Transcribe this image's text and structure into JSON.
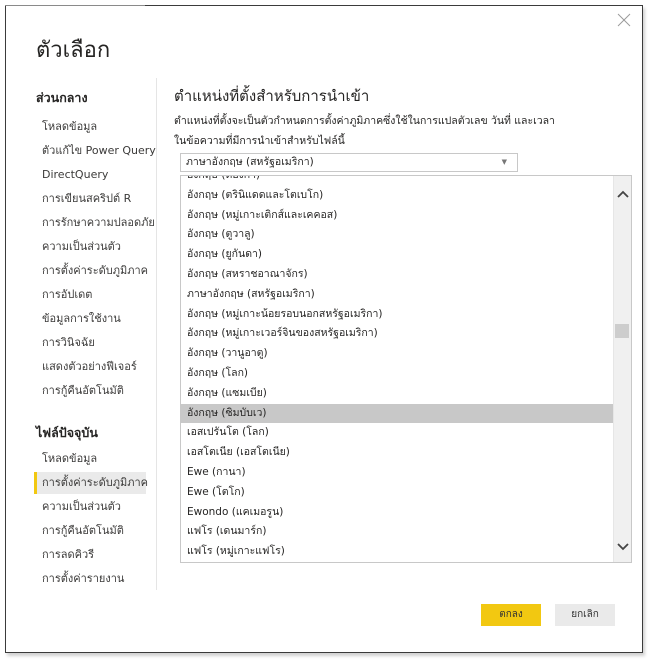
{
  "dialog": {
    "title": "ตัวเลือก",
    "close_icon": "close-icon"
  },
  "sidebar": {
    "global_heading": "ส่วนกลาง",
    "global_items": [
      "โหลดข้อมูล",
      "ตัวแก้ไข Power Query",
      "DirectQuery",
      "การเขียนสคริปต์ R",
      "การรักษาความปลอดภัย",
      "ความเป็นส่วนตัว",
      "การตั้งค่าระดับภูมิภาค",
      "การอัปเดต",
      "ข้อมูลการใช้งาน",
      "การวินิจฉัย",
      "แสดงตัวอย่างฟีเจอร์",
      "การกู้คืนอัตโนมัติ"
    ],
    "file_heading": "ไฟล์ปัจจุบัน",
    "file_items": [
      "โหลดข้อมูล",
      "การตั้งค่าระดับภูมิภาค",
      "ความเป็นส่วนตัว",
      "การกู้คืนอัตโนมัติ",
      "การลดคิวรี",
      "การตั้งค่ารายงาน"
    ],
    "selected_file_item": "การตั้งค่าระดับภูมิภาค"
  },
  "content": {
    "title": "ตำแหน่งที่ตั้งสำหรับการนำเข้า",
    "description_line1": "ตำแหน่งที่ตั้งจะเป็นตัวกำหนดการตั้งค่าภูมิภาคซึ่งใช้ในการแปลตัวเลข วันที่ และเวลา",
    "description_line2": "ในข้อความที่มีการนำเข้าสำหรับไฟล์นี้",
    "locale_select_value": "ภาษาอังกฤษ (สหรัฐอเมริกา)",
    "locale_options": [
      "อังกฤษ (ตองกา)",
      "อังกฤษ (ตรินิแดดและโตเบโก)",
      "อังกฤษ (หมู่เกาะเติกส์และเคคอส)",
      "อังกฤษ (ตูวาลู)",
      "อังกฤษ (ยูกันดา)",
      "อังกฤษ (สหราชอาณาจักร)",
      "ภาษาอังกฤษ (สหรัฐอเมริกา)",
      "อังกฤษ (หมู่เกาะน้อยรอบนอกสหรัฐอเมริกา)",
      "อังกฤษ (หมู่เกาะเวอร์จินของสหรัฐอเมริกา)",
      "อังกฤษ (วานูอาตู)",
      "อังกฤษ (โลก)",
      "อังกฤษ (แซมเบีย)",
      "อังกฤษ (ซิมบับเว)",
      "เอสเปรันโต (โลก)",
      "เอสโตเนีย (เอสโตเนีย)",
      "Ewe (กานา)",
      "Ewe (โตโก)",
      "Ewondo (แคเมอรูน)",
      "แฟโร (เดนมาร์ก)",
      "แฟโร (หมู่เกาะแฟโร)"
    ],
    "highlighted_option": "อังกฤษ (ซิมบับเว)"
  },
  "footer": {
    "ok_label": "ตกลง",
    "cancel_label": "ยกเลิก"
  },
  "colors": {
    "accent": "#f2c811",
    "highlight": "#c8c8c8"
  }
}
